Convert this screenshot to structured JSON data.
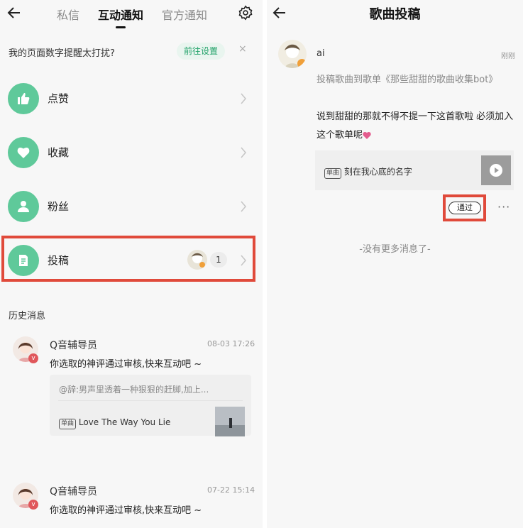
{
  "left": {
    "tabs": [
      {
        "label": "私信",
        "active": false
      },
      {
        "label": "互动通知",
        "active": true
      },
      {
        "label": "官方通知",
        "active": false
      }
    ],
    "notice": {
      "text": "我的页面数字提醒太打扰?",
      "button": "前往设置",
      "close": "×"
    },
    "rows": [
      {
        "label": "点赞",
        "icon": "thumbs-up-icon"
      },
      {
        "label": "收藏",
        "icon": "heart-icon"
      },
      {
        "label": "粉丝",
        "icon": "user-icon"
      },
      {
        "label": "投稿",
        "icon": "document-icon",
        "count": "1"
      }
    ],
    "history_title": "历史消息",
    "messages": [
      {
        "sender": "Q音辅导员",
        "time": "08-03 17:26",
        "body": "你选取的神评通过审核,快来互动吧 ~",
        "quote": "@辞:男声里透着一种狠狠的赶脚,加上...",
        "song_tag": "单曲",
        "song": "Love The Way You Lie"
      },
      {
        "sender": "Q音辅导员",
        "time": "07-22 15:14",
        "body": "你选取的神评通过审核,快来互动吧 ~"
      }
    ]
  },
  "right": {
    "title": "歌曲投稿",
    "user": "ai",
    "time": "刚刚",
    "desc": "投稿歌曲到歌单《那些甜甜的歌曲收集bot》",
    "body": "说到甜甜的那就不得不提一下这首歌啦 必须加入这个歌单呢",
    "song_tag": "单曲",
    "song": "刻在我心底的名字",
    "approve": "通过",
    "more": "···",
    "no_more": "-没有更多消息了-"
  },
  "colors": {
    "accent": "#5fc99a",
    "highlight": "#e04a3b",
    "approve_green": "#23a26a"
  }
}
